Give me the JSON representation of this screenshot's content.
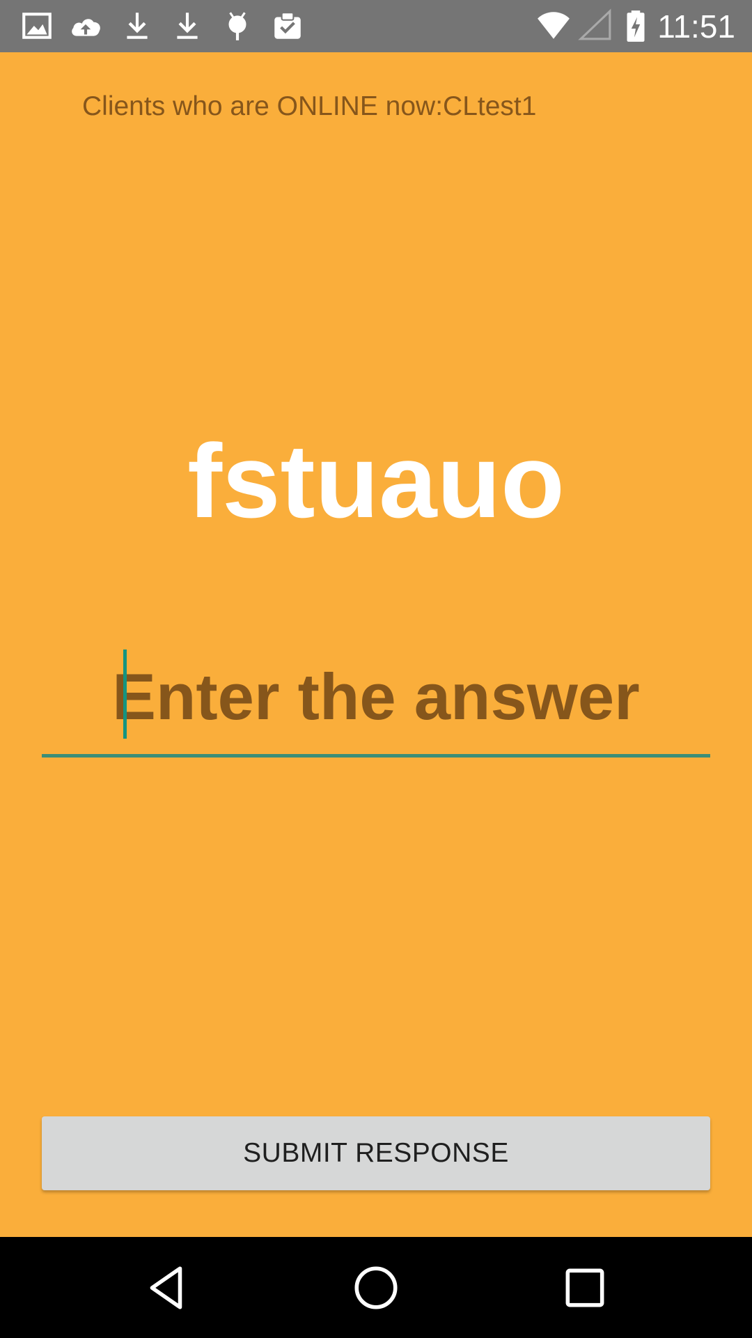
{
  "status_bar": {
    "time": "11:51",
    "icons_left": [
      "image-icon",
      "cloud-upload-icon",
      "download-icon",
      "download-icon",
      "android-icon",
      "clipboard-check-icon"
    ],
    "icons_right": [
      "wifi-icon",
      "cell-signal-icon",
      "battery-charging-icon"
    ]
  },
  "main": {
    "online_text": "Clients who are ONLINE now:CLtest1",
    "word": "fstuauo",
    "answer_placeholder": "Enter the answer",
    "answer_value": "",
    "submit_label": "SUBMIT RESPONSE"
  },
  "nav_bar": {
    "buttons": [
      "back-icon",
      "home-icon",
      "recents-icon"
    ]
  },
  "colors": {
    "background": "#FAAE3B",
    "status_bar": "#757575",
    "muted_text": "#86561B",
    "accent": "#159480",
    "button": "#D6D7D7",
    "nav_bar": "#000000"
  }
}
